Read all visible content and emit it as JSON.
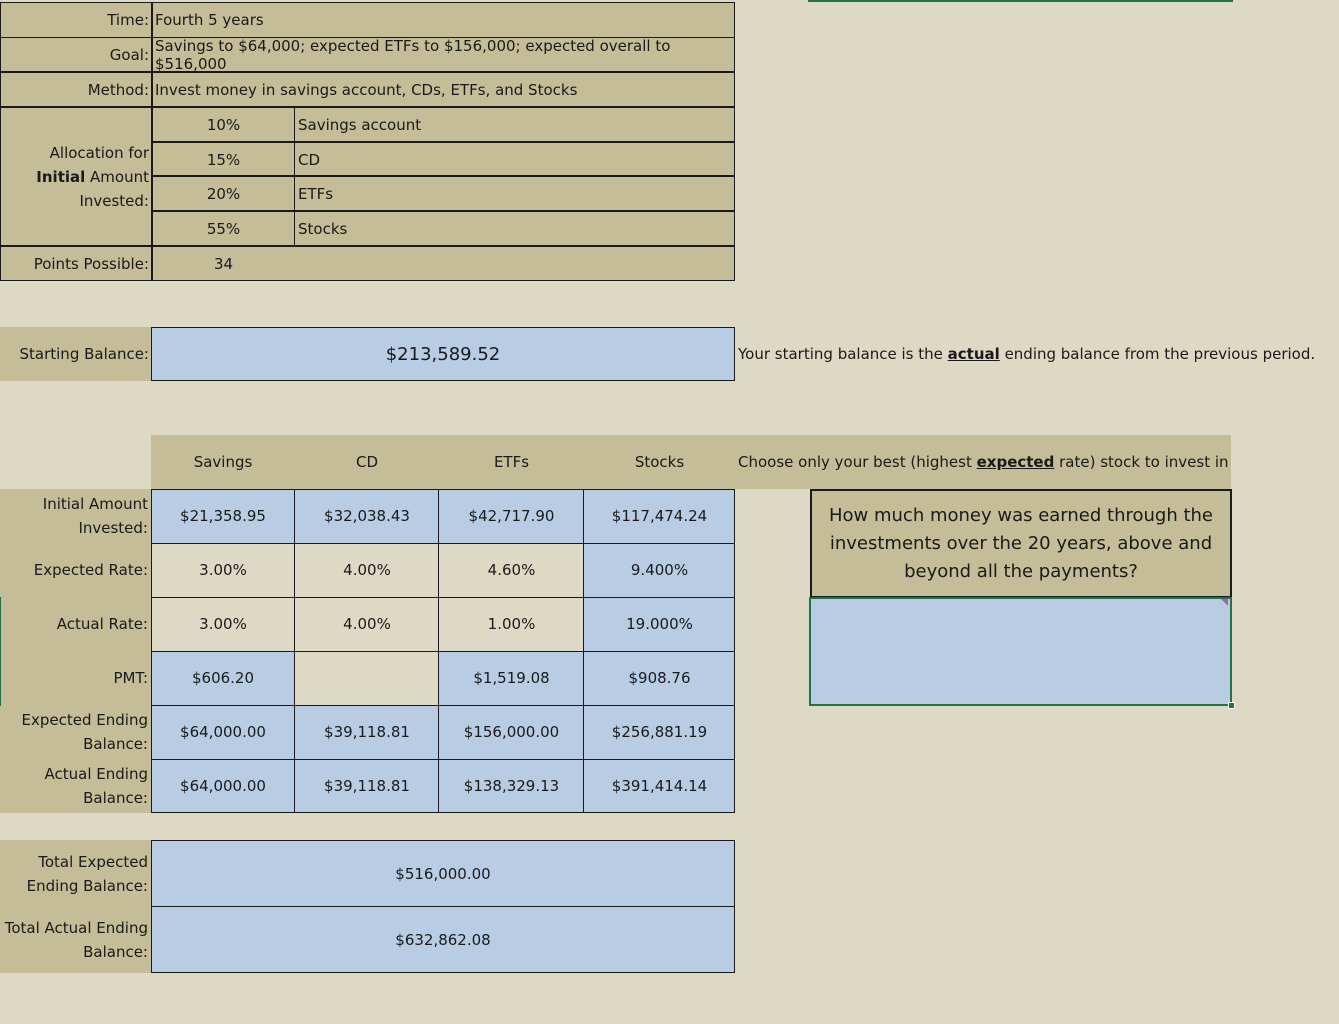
{
  "colors": {
    "background": "#ded9c4",
    "olive": "#c4bd97",
    "blue": "#b8cce4",
    "gridline": "#1a1a1a",
    "selection_green": "#217346"
  },
  "header": {
    "time_label": "Time:",
    "time_value": "Fourth 5 years",
    "goal_label": "Goal:",
    "goal_value": "Savings to $64,000; expected ETFs to $156,000; expected overall to $516,000",
    "method_label": "Method:",
    "method_value": "Invest money in savings account, CDs, ETFs, and Stocks"
  },
  "allocation": {
    "label_line1": "Allocation for",
    "label_bold": "Initial",
    "label_rest": " Amount",
    "label_line3": "Invested:",
    "rows": [
      {
        "percent": "10%",
        "name": "Savings account"
      },
      {
        "percent": "15%",
        "name": "CD"
      },
      {
        "percent": "20%",
        "name": "ETFs"
      },
      {
        "percent": "55%",
        "name": "Stocks"
      }
    ]
  },
  "points": {
    "label": "Points Possible:",
    "value": "34"
  },
  "starting": {
    "label": "Starting Balance:",
    "value": "$213,589.52",
    "note_before": "Your starting balance is the ",
    "note_bold": "actual",
    "note_after": " ending balance from the previous period."
  },
  "table": {
    "headers": [
      "Savings",
      "CD",
      "ETFs",
      "Stocks"
    ],
    "note_before": "Choose only your best (highest ",
    "note_bold": "expected",
    "note_after": " rate) stock to invest in",
    "rows": [
      {
        "label1": "Initial Amount",
        "label2": "Invested:",
        "values": [
          "$21,358.95",
          "$32,038.43",
          "$42,717.90",
          "$117,474.24"
        ]
      },
      {
        "label1": "Expected Rate:",
        "label2": "",
        "values": [
          "3.00%",
          "4.00%",
          "4.60%",
          "9.400%"
        ]
      },
      {
        "label1": "Actual Rate:",
        "label2": "",
        "values": [
          "3.00%",
          "4.00%",
          "1.00%",
          "19.000%"
        ]
      },
      {
        "label1": "PMT:",
        "label2": "",
        "values": [
          "$606.20",
          "",
          "$1,519.08",
          "$908.76"
        ]
      },
      {
        "label1": "Expected Ending",
        "label2": "Balance:",
        "values": [
          "$64,000.00",
          "$39,118.81",
          "$156,000.00",
          "$256,881.19"
        ]
      },
      {
        "label1": "Actual Ending",
        "label2": "Balance:",
        "values": [
          "$64,000.00",
          "$39,118.81",
          "$138,329.13",
          "$391,414.14"
        ]
      }
    ]
  },
  "totals": {
    "expected_label1": "Total Expected",
    "expected_label2": "Ending Balance:",
    "expected_value": "$516,000.00",
    "actual_label1": "Total Actual Ending",
    "actual_label2": "Balance:",
    "actual_value": "$632,862.08"
  },
  "question": {
    "text": "How much money was earned through the investments over the 20 years, above and beyond all the payments?",
    "answer": ""
  }
}
